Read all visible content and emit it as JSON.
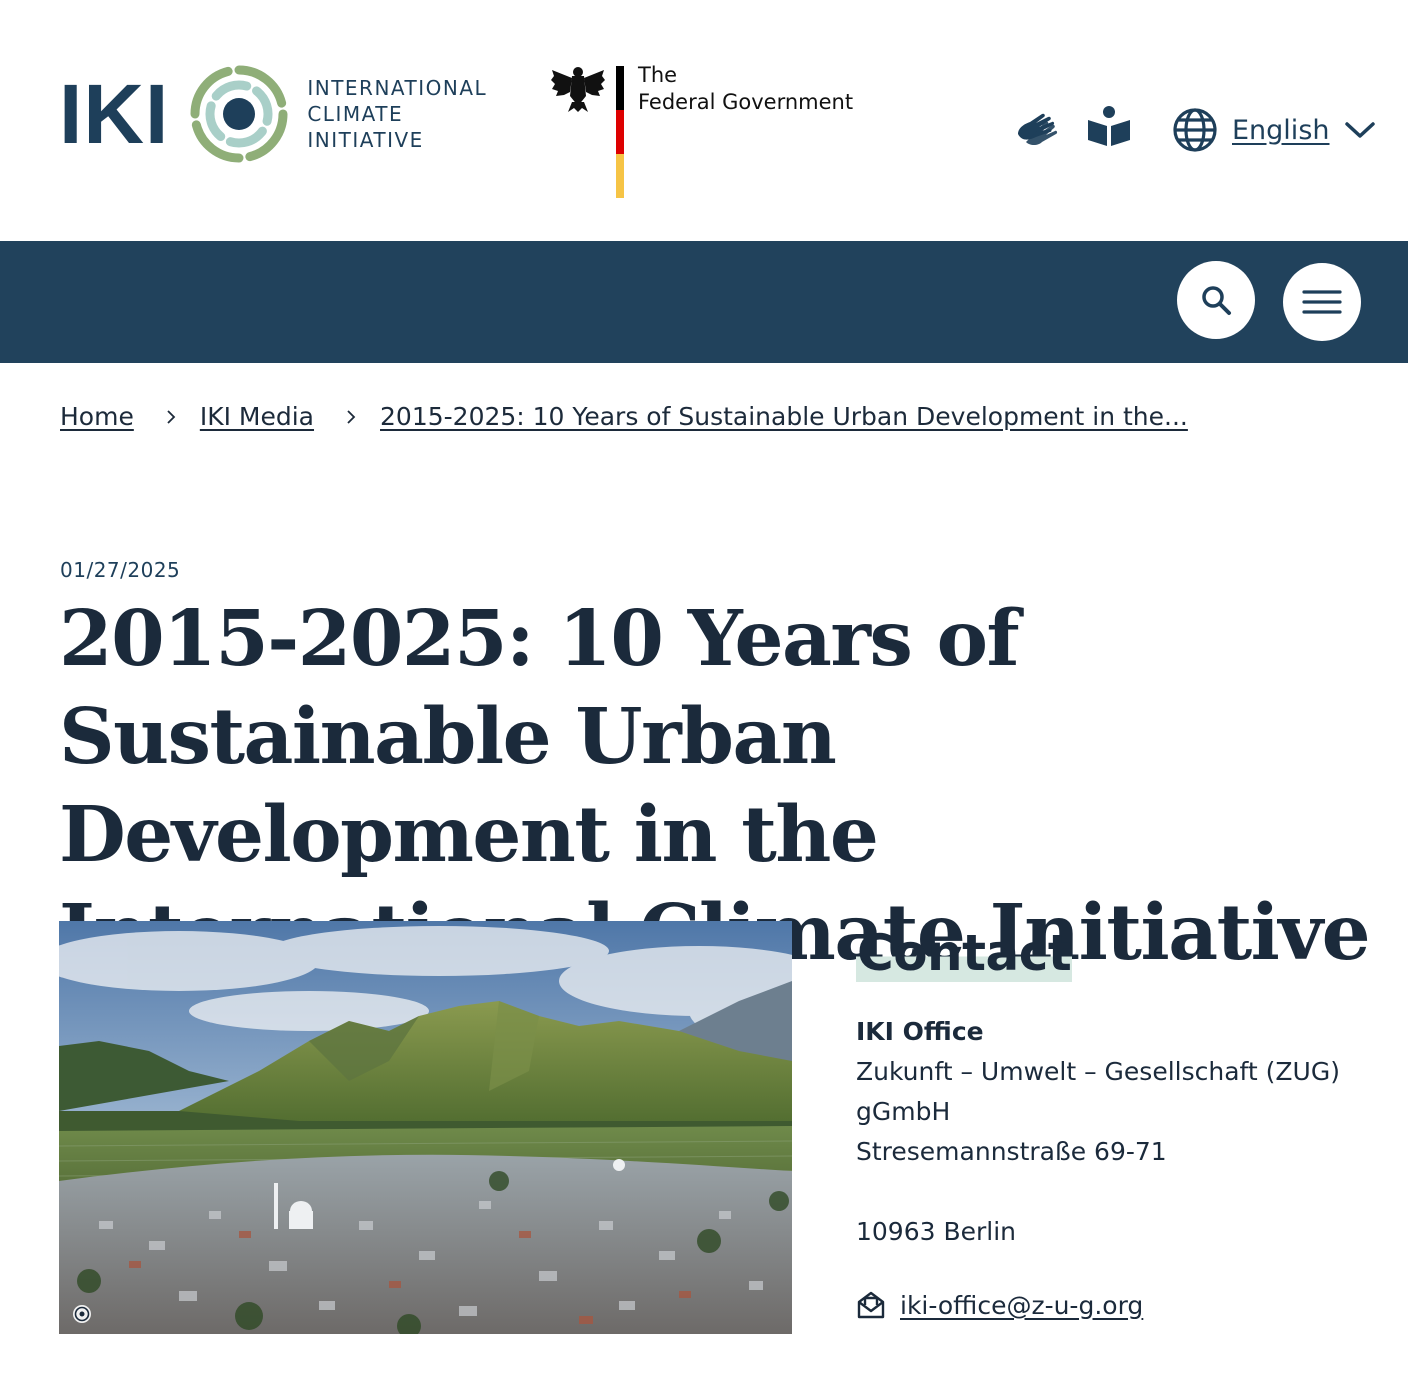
{
  "header": {
    "logo_short": "IKI",
    "logo_tagline": [
      "INTERNATIONAL",
      "CLIMATE",
      "INITIATIVE"
    ],
    "gov_logo": [
      "The",
      "Federal Government"
    ],
    "sign_language_icon": "sign-language-icon",
    "easy_read_icon": "book-reader-icon",
    "language": "English"
  },
  "navbar": {
    "search_icon": "search-icon",
    "menu_icon": "hamburger-menu-icon",
    "background": "#21425c"
  },
  "breadcrumb": {
    "items": [
      "Home",
      "IKI Media",
      "2015-2025: 10 Years of Sustainable Urban Development in the..."
    ]
  },
  "article": {
    "date": "01/27/2025",
    "title": "2015-2025: 10 Years of Sustainable Urban Development in the International Climate Initiative",
    "image_icon": "copyright-icon"
  },
  "contact": {
    "heading": "Contact",
    "office": "IKI Office",
    "org_line1": "Zukunft – Umwelt – Gesellschaft (ZUG)",
    "org_line2": "gGmbH",
    "street": "Stresemannstraße 69-71",
    "city": "10963 Berlin",
    "email": "iki-office@z-u-g.org",
    "email_icon": "mail-icon"
  },
  "colors": {
    "brand_navy": "#1e3f5a",
    "brand_green": "#8fae78",
    "brand_teal": "#a9cfc8",
    "text": "#1b2a3b",
    "highlight": "#d6e8e1"
  }
}
